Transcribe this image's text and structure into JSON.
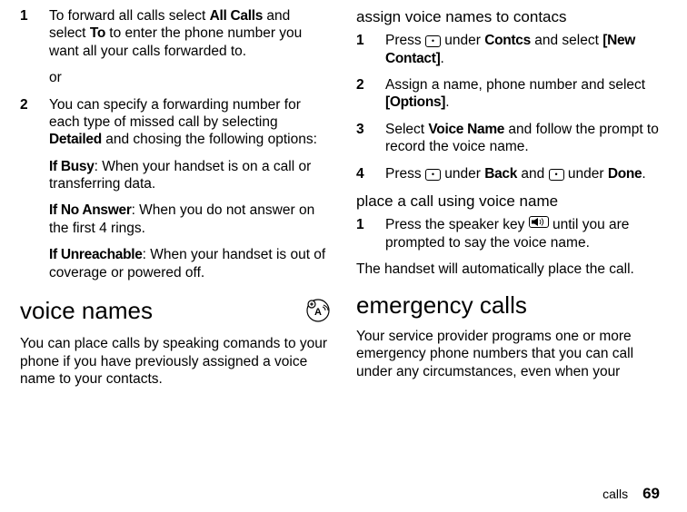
{
  "left": {
    "step1_num": "1",
    "step1_a": "To forward all calls select ",
    "step1_b": "All Calls",
    "step1_c": " and select ",
    "step1_d": "To",
    "step1_e": " to enter the phone number you want all your calls forwarded to.",
    "or": "or",
    "step2_num": "2",
    "step2_a": "You can specify a forwarding number for each type of missed call by selecting ",
    "step2_b": "Detailed",
    "step2_c": " and chosing the following options:",
    "ifbusy_a": "If Busy",
    "ifbusy_b": ": When your handset is on a call or transferring data.",
    "ifna_a": "If No Answer",
    "ifna_b": ": When you do not answer on the first 4 rings.",
    "ifun_a": "If Unreachable",
    "ifun_b": ": When your handset is out of coverage or powered off.",
    "h2": "voice names",
    "vn_para": "You can place calls by speaking comands to your phone if you have previously assigned a voice name to your contacts."
  },
  "right": {
    "h3a": "assign voice names to contacs",
    "s1_num": "1",
    "s1_a": "Press ",
    "s1_b": " under ",
    "s1_c": "Contcs",
    "s1_d": " and select ",
    "s1_e": "[New Contact]",
    "s1_f": ".",
    "s2_num": "2",
    "s2_a": "Assign a name, phone number and select ",
    "s2_b": "[Options]",
    "s2_c": ".",
    "s3_num": "3",
    "s3_a": "Select ",
    "s3_b": "Voice Name",
    "s3_c": " and follow the prompt to record the voice name.",
    "s4_num": "4",
    "s4_a": "Press ",
    "s4_b": " under ",
    "s4_c": "Back",
    "s4_d": " and ",
    "s4_e": " under ",
    "s4_f": "Done",
    "s4_g": ".",
    "h3b": "place a call using voice name",
    "p1_num": "1",
    "p1_a": "Press the speaker key ",
    "p1_b": " until you are prompted to say the voice name.",
    "auto": "The handset will automatically place the call.",
    "h2": "emergency calls",
    "em_para": "Your service provider programs one or more emergency phone numbers that you can call under any circumstances, even when your"
  },
  "footer": {
    "section": "calls",
    "page": "69"
  }
}
